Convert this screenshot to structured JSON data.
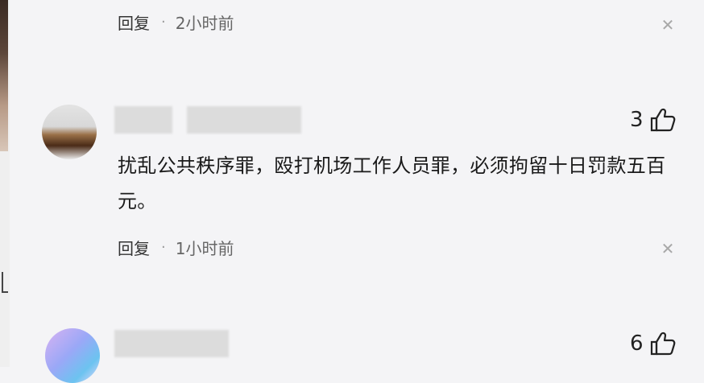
{
  "comments": [
    {
      "reply_label": "回复",
      "separator": "·",
      "time": "2小时前"
    },
    {
      "likes": "3",
      "text": "扰乱公共秩序罪，殴打机场工作人员罪，必须拘留十日罚款五百元。",
      "reply_label": "回复",
      "separator": "·",
      "time": "1小时前"
    },
    {
      "likes": "6"
    }
  ],
  "icons": {
    "like": "thumbs-up-icon",
    "dismiss": "close-icon"
  },
  "colors": {
    "background": "#f4f4f6",
    "text": "#1f1f1f",
    "muted": "#666666"
  }
}
